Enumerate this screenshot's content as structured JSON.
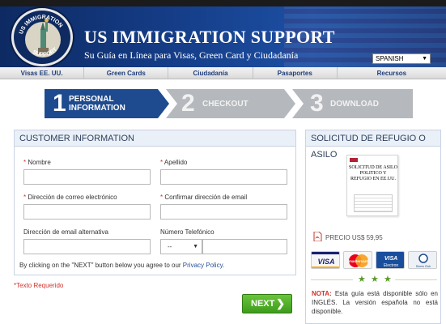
{
  "header": {
    "logo_text_top": "US IMMIGRATION",
    "logo_text_bottom": "SUPPORT",
    "title": "US IMMIGRATION SUPPORT",
    "subtitle": "Su Guía en Línea para Visas, Green Card y Ciudadanía",
    "language": "SPANISH"
  },
  "nav": {
    "items": [
      {
        "label": "Visas EE. UU."
      },
      {
        "label": "Green Cards"
      },
      {
        "label": "Ciudadanía"
      },
      {
        "label": "Pasaportes"
      },
      {
        "label": "Recursos"
      }
    ]
  },
  "steps": [
    {
      "number": "1",
      "line1": "PERSONAL",
      "line2": "INFORMATION",
      "active": true
    },
    {
      "number": "2",
      "line1": "CHECKOUT",
      "line2": "",
      "active": false
    },
    {
      "number": "3",
      "line1": "DOWNLOAD",
      "line2": "",
      "active": false
    }
  ],
  "customer": {
    "heading": "CUSTOMER INFORMATION",
    "fields": {
      "nombre": {
        "label": "Nombre",
        "required": true,
        "value": ""
      },
      "apellido": {
        "label": "Apellido",
        "required": true,
        "value": ""
      },
      "email": {
        "label": "Dirección de correo electrónico",
        "required": true,
        "value": ""
      },
      "confirm_email": {
        "label": "Confirmar dirección de email",
        "required": true,
        "value": ""
      },
      "alt_email": {
        "label": "Dirección de email alternativa",
        "required": false,
        "value": ""
      },
      "telefono": {
        "label": "Número Telefónico",
        "required": false,
        "value": "",
        "prefix": "--"
      }
    },
    "agree_text": "By clicking on the \"NEXT\" button below you agree to our ",
    "privacy_link": "Privacy Policy",
    "agree_end": "."
  },
  "required_note": "*Texto Requerido",
  "next_button": {
    "label": "NEXT",
    "icon": "chevron-right-icon"
  },
  "product": {
    "heading": "SOLICITUD DE REFUGIO O ASILO",
    "book_title": "SOLICITUD DE ASILO POLITICO Y REFUGIO EN EE.UU.",
    "price": "PRECIO US$ 59,95",
    "cards": [
      "VISA",
      "mastercard",
      "VISA Electron",
      "Diners Club"
    ],
    "note_label": "NOTA:",
    "note_text": " Esta guía está disponible sólo en INGLÉS. La versión española no está disponible."
  },
  "colors": {
    "header_blue": "#143b84",
    "step_active": "#1e4b8f",
    "step_inactive": "#b5b8bc",
    "required_red": "#d0312d",
    "next_green": "#4aab26"
  }
}
